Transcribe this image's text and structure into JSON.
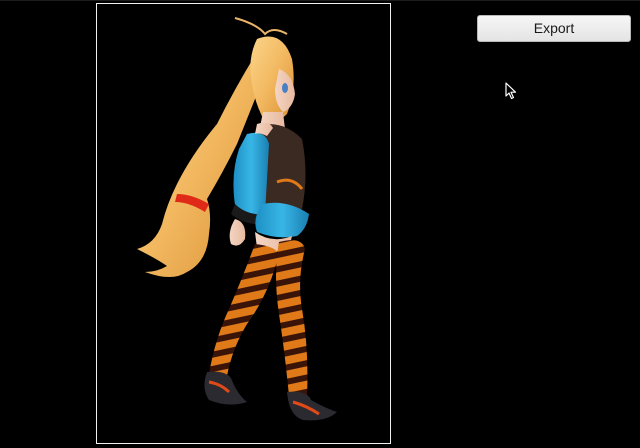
{
  "toolbar": {
    "export_label": "Export"
  },
  "viewport": {
    "content": "3d-character-walking"
  },
  "icons": {
    "cursor": "mouse-pointer-icon"
  },
  "colors": {
    "background": "#000000",
    "viewport_border": "#f0f0f0",
    "button_bg": "#eeeeee",
    "button_border": "#b8b8b8",
    "hair": "#f2b860",
    "jacket": "#2aa6d8",
    "vest": "#3a2a22",
    "stocking_orange": "#e07a18",
    "stocking_dark": "#3a1408"
  }
}
